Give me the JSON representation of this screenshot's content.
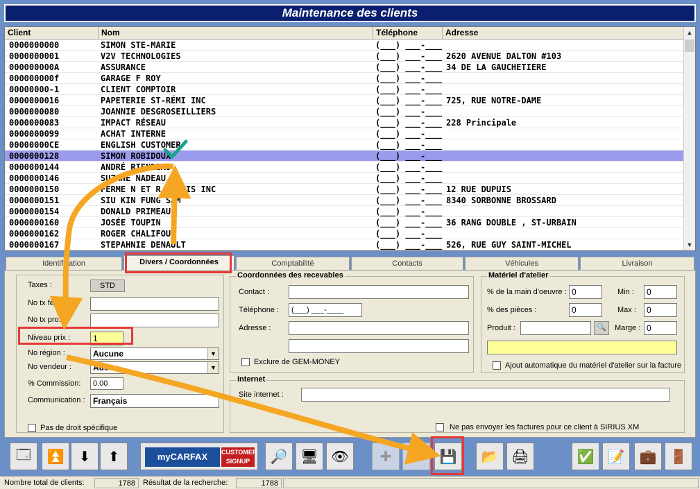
{
  "window": {
    "title": "Maintenance des clients"
  },
  "list": {
    "headers": [
      "Client",
      "Nom",
      "Téléphone",
      "Adresse"
    ],
    "rows": [
      {
        "client": "0000000000",
        "nom": "SIMON STE-MARIE",
        "tel": "(___) ___-____",
        "adr": ""
      },
      {
        "client": "0000000001",
        "nom": "V2V TECHNOLOGIES",
        "tel": "(___) ___-____",
        "adr": "2620 AVENUE DALTON #103"
      },
      {
        "client": "000000000A",
        "nom": "ASSURANCE",
        "tel": "(___) ___-____",
        "adr": "34 DE LA GAUCHETIERE"
      },
      {
        "client": "000000000f",
        "nom": "GARAGE F ROY",
        "tel": "(___) ___-____",
        "adr": ""
      },
      {
        "client": "00000000-1",
        "nom": "CLIENT COMPTOIR",
        "tel": "(___) ___-____",
        "adr": ""
      },
      {
        "client": "0000000016",
        "nom": "PAPETERIE ST-RÉMI INC",
        "tel": "(___) ___-____",
        "adr": "725, RUE NOTRE-DAME"
      },
      {
        "client": "0000000080",
        "nom": "JOANNIE DESGROSEILLIERS",
        "tel": "(___) ___-____",
        "adr": ""
      },
      {
        "client": "0000000083",
        "nom": "IMPACT RÉSEAU",
        "tel": "(___) ___-____",
        "adr": "228 Principale"
      },
      {
        "client": "0000000099",
        "nom": "ACHAT INTERNE",
        "tel": "(___) ___-____",
        "adr": ""
      },
      {
        "client": "00000000CE",
        "nom": "ENGLISH CUSTOMER",
        "tel": "(___) ___-____",
        "adr": ""
      },
      {
        "client": "0000000128",
        "nom": "SIMON ROBIDOUX",
        "tel": "(___) ___-____",
        "adr": ""
      },
      {
        "client": "0000000144",
        "nom": "ANDRÉ RIENDEAU",
        "tel": "(___) ___-____",
        "adr": ""
      },
      {
        "client": "0000000146",
        "nom": "SUZANE NADEAU",
        "tel": "(___) ___-____",
        "adr": ""
      },
      {
        "client": "0000000150",
        "nom": "FERME N ET R DUPUIS INC",
        "tel": "(___) ___-____",
        "adr": "12 RUE DUPUIS"
      },
      {
        "client": "0000000151",
        "nom": "SIU KIN FUNG SAM",
        "tel": "(___) ___-____",
        "adr": "8340 SORBONNE BROSSARD"
      },
      {
        "client": "0000000154",
        "nom": "DONALD PRIMEAU",
        "tel": "(___) ___-____",
        "adr": ""
      },
      {
        "client": "0000000160",
        "nom": "JOSÉE TOUPIN",
        "tel": "(___) ___-____",
        "adr": "36 RANG DOUBLE , ST-URBAIN"
      },
      {
        "client": "0000000162",
        "nom": "ROGER CHALIFOUX",
        "tel": "(___) ___-____",
        "adr": ""
      },
      {
        "client": "0000000167",
        "nom": "STEPAHNIE DENAULT",
        "tel": "(___) ___-____",
        "adr": "526, RUE GUY SAINT-MICHEL"
      }
    ],
    "selected_row": 10
  },
  "tabs": [
    "Identification",
    "Divers / Coordonnées",
    "Comptabilité",
    "Contacts",
    "Véhicules",
    "Livraison"
  ],
  "left": {
    "taxes_label": "Taxes :",
    "taxes_value": "STD",
    "no_tx_fed_label": "No tx féd. :",
    "no_tx_pro_label": "No tx pro. :",
    "niveau_prix_label": "Niveau prix :",
    "niveau_prix_value": "1",
    "no_region_label": "No région :",
    "no_region_value": "Aucune",
    "no_vendeur_label": "No vendeur :",
    "no_vendeur_value": "Aucun",
    "commission_label": "% Commission:",
    "commission_value": "0.00",
    "communication_label": "Communication :",
    "communication_value": "Français",
    "pas_de_droit_label": "Pas de droit spécifique"
  },
  "recevables": {
    "title": "Coordonnées des recevables",
    "contact_label": "Contact :",
    "telephone_label": "Téléphone :",
    "telephone_value": "(___) ___-____",
    "adresse_label": "Adresse :",
    "exclure_label": "Exclure de GEM-MONEY"
  },
  "materiel": {
    "title": "Matériel d'atelier",
    "main_oeuvre_label": "% de la main d'oeuvre :",
    "main_oeuvre_value": "0",
    "min_label": "Min :",
    "min_value": "0",
    "pieces_label": "% des pièces :",
    "pieces_value": "0",
    "max_label": "Max :",
    "max_value": "0",
    "produit_label": "Produit :",
    "marge_label": "Marge :",
    "marge_value": "0",
    "ajout_label": "Ajout automatique du matériel d'atelier sur la facture"
  },
  "internet": {
    "title": "Internet",
    "site_label": "Site internet :",
    "sirius_label": "Ne pas envoyer les factures pour ce client à SIRIUS XM"
  },
  "carfax": {
    "brand": "myCARFAX",
    "signup": "CUSTOMER SIGNUP"
  },
  "status": {
    "total_label": "Nombre total de clients:",
    "total_value": "1788",
    "result_label": "Résultat de la recherche:",
    "result_value": "1788"
  },
  "icons": [
    "window-icon",
    "up-circle-icon",
    "down-circle-icon",
    "up-arrow-icon",
    "magnifier-icon",
    "monitor-icon",
    "eye-search-icon",
    "add-icon",
    "minus-icon",
    "save-icon",
    "folder-icon",
    "printer-icon",
    "check-mail-icon",
    "edit-doc-icon",
    "briefcase-icon",
    "exit-icon"
  ],
  "colors": {
    "title_bg": "#0a1f6e",
    "selected_row": "#9b9bee",
    "highlight": "#e53935",
    "arrow": "#f5a623",
    "check": "#1aa38c"
  }
}
